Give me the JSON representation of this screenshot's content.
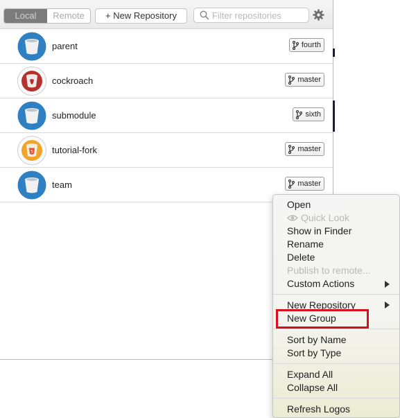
{
  "toolbar": {
    "tabs": [
      {
        "label": "Local",
        "active": true
      },
      {
        "label": "Remote",
        "active": false
      }
    ],
    "new_repo_label": "+ New Repository",
    "search_placeholder": "Filter repositories",
    "search_icon": "magnifier-icon",
    "settings_icon": "gear-icon"
  },
  "repos": [
    {
      "name": "parent",
      "branch": "fourth",
      "avatar": "blue-bucket-icon",
      "avatar_color": "#2f7fc3"
    },
    {
      "name": "cockroach",
      "branch": "master",
      "avatar": "red-bucket-icon",
      "avatar_color": "#b3322f"
    },
    {
      "name": "submodule",
      "branch": "sixth",
      "avatar": "blue-bucket-icon",
      "avatar_color": "#2f7fc3"
    },
    {
      "name": "tutorial-fork",
      "branch": "master",
      "avatar": "html5-bucket-icon",
      "avatar_color": "#f1a52b"
    },
    {
      "name": "team",
      "branch": "master",
      "avatar": "blue-bucket-icon",
      "avatar_color": "#2f7fc3"
    }
  ],
  "menu": {
    "open": "Open",
    "quick_look": "Quick Look",
    "show_in_finder": "Show in Finder",
    "rename": "Rename",
    "delete": "Delete",
    "publish": "Publish to remote...",
    "custom_actions": "Custom Actions",
    "new_repository": "New Repository",
    "new_group": "New Group",
    "sort_by_name": "Sort by Name",
    "sort_by_type": "Sort by Type",
    "expand_all": "Expand All",
    "collapse_all": "Collapse All",
    "refresh_logos": "Refresh Logos"
  },
  "colors": {
    "highlight": "#dd0d1e",
    "active_tab": "#7c7c7c"
  }
}
